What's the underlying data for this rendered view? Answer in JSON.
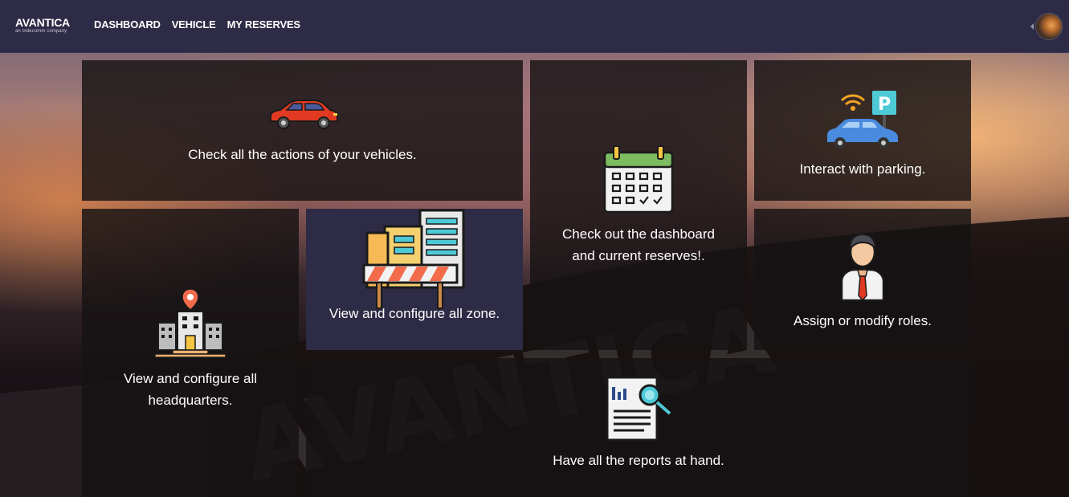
{
  "app": {
    "logo_text": "AVANTICA",
    "logo_subtext": "an Indecomm company"
  },
  "nav": {
    "items": [
      {
        "label": "DASHBOARD"
      },
      {
        "label": "VEHICLE"
      },
      {
        "label": "MY RESERVES"
      }
    ]
  },
  "cards": {
    "vehicles": {
      "text": "Check all the actions of your vehicles.",
      "icon": "car-icon"
    },
    "dashboard": {
      "text_line1": "Check out the dashboard",
      "text_line2": "and current reserves!.",
      "icon": "calendar-icon"
    },
    "parking": {
      "text": "Interact with parking.",
      "icon": "parking-car-icon"
    },
    "headquarters": {
      "text_line1": "View and configure all",
      "text_line2": "headquarters.",
      "icon": "building-location-icon"
    },
    "zone": {
      "text": "View and configure all zone.",
      "icon": "construction-zone-icon"
    },
    "roles": {
      "text": "Assign or modify roles.",
      "icon": "businessman-icon"
    },
    "reports": {
      "text": "Have all the reports at hand.",
      "icon": "report-search-icon"
    }
  },
  "colors": {
    "topbar": "#2d2b45",
    "card_bg": "#161214",
    "zone_card_bg": "#2d2b45",
    "text": "#ffffff"
  }
}
